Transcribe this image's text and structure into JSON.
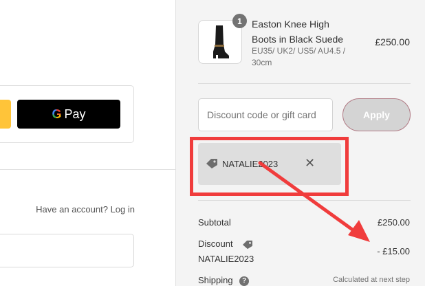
{
  "left": {
    "express": {
      "gpay_label": "Pay",
      "gpay_g": "G"
    },
    "account": {
      "prompt": "Have an account?",
      "login_link": "Log in"
    }
  },
  "cart": {
    "item": {
      "quantity": "1",
      "name": "Easton Knee High Boots in Black Suede",
      "variant": "EU35/ UK2/ US5/ AU4.5 / 30cm",
      "price": "£250.00"
    },
    "discount": {
      "placeholder": "Discount code or gift card",
      "apply_label": "Apply",
      "applied_code": "NATALIE2023",
      "remove_symbol": "✕"
    },
    "summary": {
      "subtotal_label": "Subtotal",
      "subtotal_value": "£250.00",
      "discount_label": "Discount",
      "discount_code": "NATALIE2023",
      "discount_value": "- £15.00",
      "shipping_label": "Shipping",
      "shipping_help": "?",
      "shipping_value": "Calculated at next step"
    }
  },
  "annotation": {
    "color": "#f03c3c"
  },
  "colors": {
    "sidebar_bg": "#f4f4f4",
    "apply_bg": "#d4d4d4",
    "apply_border": "#b07a84",
    "gpay_bg": "#000000"
  }
}
